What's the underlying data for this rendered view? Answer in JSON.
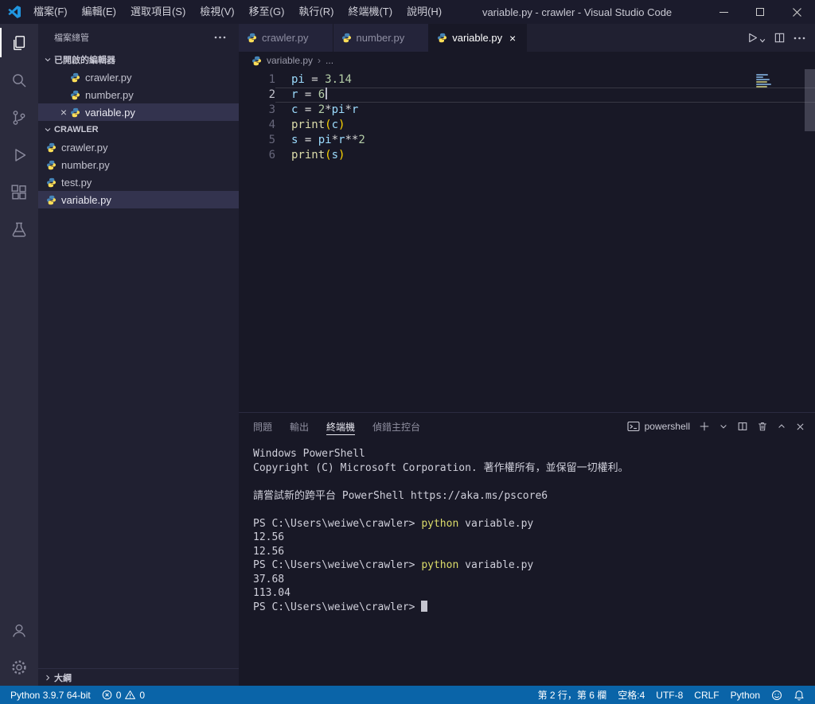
{
  "titlebar": {
    "title": "variable.py - crawler - Visual Studio Code",
    "menus": [
      {
        "key": "file",
        "label": "檔案(F)"
      },
      {
        "key": "edit",
        "label": "編輯(E)"
      },
      {
        "key": "selection",
        "label": "選取項目(S)"
      },
      {
        "key": "view",
        "label": "檢視(V)"
      },
      {
        "key": "go",
        "label": "移至(G)"
      },
      {
        "key": "run",
        "label": "執行(R)"
      },
      {
        "key": "terminal",
        "label": "終端機(T)"
      },
      {
        "key": "help",
        "label": "說明(H)"
      }
    ]
  },
  "sidebar": {
    "title": "檔案總管",
    "open_editors": {
      "label": "已開啟的編輯器",
      "files": [
        {
          "name": "crawler.py",
          "selected": false
        },
        {
          "name": "number.py",
          "selected": false
        },
        {
          "name": "variable.py",
          "selected": true
        }
      ]
    },
    "folder": {
      "label": "CRAWLER",
      "files": [
        {
          "name": "crawler.py",
          "selected": false
        },
        {
          "name": "number.py",
          "selected": false
        },
        {
          "name": "test.py",
          "selected": false
        },
        {
          "name": "variable.py",
          "selected": true
        }
      ]
    },
    "outline_label": "大綱"
  },
  "editor": {
    "tabs": [
      {
        "label": "crawler.py",
        "active": false
      },
      {
        "label": "number.py",
        "active": false
      },
      {
        "label": "variable.py",
        "active": true
      }
    ],
    "breadcrumb": {
      "file": "variable.py",
      "more": "..."
    },
    "lines": [
      {
        "num": "1",
        "tokens": [
          [
            "v",
            "pi"
          ],
          [
            "o",
            " = "
          ],
          [
            "n",
            "3.14"
          ]
        ]
      },
      {
        "num": "2",
        "current": true,
        "tokens": [
          [
            "v",
            "r"
          ],
          [
            "o",
            " = "
          ],
          [
            "n",
            "6"
          ]
        ]
      },
      {
        "num": "3",
        "tokens": [
          [
            "v",
            "c"
          ],
          [
            "o",
            " = "
          ],
          [
            "n",
            "2"
          ],
          [
            "o",
            "*"
          ],
          [
            "v",
            "pi"
          ],
          [
            "o",
            "*"
          ],
          [
            "v",
            "r"
          ]
        ]
      },
      {
        "num": "4",
        "tokens": [
          [
            "f",
            "print"
          ],
          [
            "b",
            "("
          ],
          [
            "v",
            "c"
          ],
          [
            "b",
            ")"
          ]
        ]
      },
      {
        "num": "5",
        "tokens": [
          [
            "v",
            "s"
          ],
          [
            "o",
            " = "
          ],
          [
            "v",
            "pi"
          ],
          [
            "o",
            "*"
          ],
          [
            "v",
            "r"
          ],
          [
            "o",
            "**"
          ],
          [
            "n",
            "2"
          ]
        ]
      },
      {
        "num": "6",
        "tokens": [
          [
            "f",
            "print"
          ],
          [
            "b",
            "("
          ],
          [
            "v",
            "s"
          ],
          [
            "b",
            ")"
          ]
        ]
      }
    ]
  },
  "panel": {
    "tabs": [
      {
        "key": "problems",
        "label": "問題",
        "active": false
      },
      {
        "key": "output",
        "label": "輸出",
        "active": false
      },
      {
        "key": "terminal",
        "label": "終端機",
        "active": true
      },
      {
        "key": "debug-console",
        "label": "偵錯主控台",
        "active": false
      }
    ],
    "shell_label": "powershell",
    "terminal_lines": [
      [
        [
          "t",
          "Windows PowerShell"
        ]
      ],
      [
        [
          "t",
          "Copyright (C) Microsoft Corporation. 著作權所有，並保留一切權利。"
        ]
      ],
      [],
      [
        [
          "t",
          "請嘗試新的跨平台 PowerShell https://aka.ms/pscore6"
        ]
      ],
      [],
      [
        [
          "t",
          "PS C:\\Users\\weiwe\\crawler> "
        ],
        [
          "y",
          "python"
        ],
        [
          "t",
          " variable.py"
        ]
      ],
      [
        [
          "t",
          "12.56"
        ]
      ],
      [
        [
          "t",
          "12.56"
        ]
      ],
      [
        [
          "t",
          "PS C:\\Users\\weiwe\\crawler> "
        ],
        [
          "y",
          "python"
        ],
        [
          "t",
          " variable.py"
        ]
      ],
      [
        [
          "t",
          "37.68"
        ]
      ],
      [
        [
          "t",
          "113.04"
        ]
      ],
      [
        [
          "t",
          "PS C:\\Users\\weiwe\\crawler> "
        ],
        [
          "cursor",
          ""
        ]
      ]
    ]
  },
  "statusbar": {
    "python_version": "Python 3.9.7 64-bit",
    "errors": "0",
    "warnings": "0",
    "cursor_position": "第 2 行，第 6 欄",
    "indentation": "空格:4",
    "encoding": "UTF-8",
    "eol": "CRLF",
    "language": "Python"
  },
  "colors": {
    "statusbar_bg": "#0a64a8",
    "accent_blue": "#1f9cf0",
    "python_icon_blue": "#4584b6",
    "python_icon_yellow": "#ffde57",
    "terminal_command_yellow": "#dcdc6a"
  }
}
